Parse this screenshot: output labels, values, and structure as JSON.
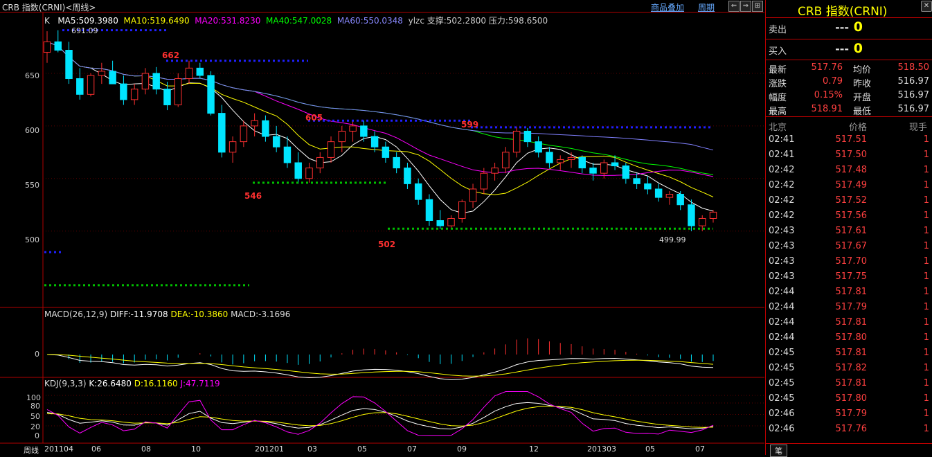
{
  "header": {
    "title": "CRB 指数(CRNI)<周线>",
    "links": [
      "商品叠加",
      "周期"
    ],
    "nav_buttons": [
      "⇐",
      "⇒",
      "⊞",
      "⊟"
    ],
    "close_glyph": "✕"
  },
  "main_legend": {
    "k": "K",
    "ma5": "MA5:509.3980",
    "ma10": "MA10:519.6490",
    "ma20": "MA20:531.8230",
    "ma40": "MA40:547.0028",
    "ma60": "MA60:550.0348",
    "ylzc": "ylzc 支撑:502.2800 压力:598.6500"
  },
  "annotations": {
    "high_691": "691.09",
    "peak_662": "662",
    "peak_605": "605",
    "peak_599": "599",
    "low_546": "546",
    "low_502": "502",
    "low_499": "499.99"
  },
  "macd_legend": {
    "name": "MACD(26,12,9)",
    "diff": "DIFF:-11.9708",
    "dea": "DEA:-10.3860",
    "macd": "MACD:-3.1696"
  },
  "kdj_legend": {
    "name": "KDJ(9,3,3)",
    "k": "K:26.6480",
    "d": "D:16.1160",
    "j": "J:47.7119"
  },
  "y_axis_main": [
    "650",
    "600",
    "550",
    "500"
  ],
  "y_axis_macd": [
    "0"
  ],
  "y_axis_kdj": [
    "100",
    "80",
    "50",
    "20",
    "0"
  ],
  "x_axis": {
    "period_label": "周线",
    "ticks": [
      "201104",
      "06",
      "08",
      "10",
      "201201",
      "03",
      "05",
      "07",
      "09",
      "12",
      "201303",
      "05",
      "07"
    ]
  },
  "colors": {
    "up": "#ff3030",
    "down": "#00e5ff",
    "ma5": "#ffffff",
    "ma10": "#ffff00",
    "ma20": "#ff00ff",
    "ma40": "#00ff00",
    "ma60": "#8080ff",
    "resistance": "#2020ff",
    "support": "#00c000"
  },
  "quote": {
    "title": "CRB 指数(CRNI)",
    "sell_label": "卖出",
    "sell_price": "---",
    "sell_vol": "0",
    "buy_label": "买入",
    "buy_price": "---",
    "buy_vol": "0",
    "stats": [
      {
        "l1": "最新",
        "v1": "517.76",
        "l2": "均价",
        "v2": "518.50"
      },
      {
        "l1": "涨跌",
        "v1": "0.79",
        "l2": "昨收",
        "v2": "516.97"
      },
      {
        "l1": "幅度",
        "v1": "0.15%",
        "l2": "开盘",
        "v2": "516.97"
      },
      {
        "l1": "最高",
        "v1": "518.91",
        "l2": "最低",
        "v2": "516.97"
      }
    ],
    "trades_header": {
      "time": "北京",
      "price": "价格",
      "vol": "现手"
    },
    "trades": [
      {
        "time": "02:41",
        "price": "517.51",
        "vol": "1"
      },
      {
        "time": "02:41",
        "price": "517.50",
        "vol": "1"
      },
      {
        "time": "02:42",
        "price": "517.48",
        "vol": "1"
      },
      {
        "time": "02:42",
        "price": "517.49",
        "vol": "1"
      },
      {
        "time": "02:42",
        "price": "517.52",
        "vol": "1"
      },
      {
        "time": "02:42",
        "price": "517.56",
        "vol": "1"
      },
      {
        "time": "02:43",
        "price": "517.61",
        "vol": "1"
      },
      {
        "time": "02:43",
        "price": "517.67",
        "vol": "1"
      },
      {
        "time": "02:43",
        "price": "517.70",
        "vol": "1"
      },
      {
        "time": "02:43",
        "price": "517.75",
        "vol": "1"
      },
      {
        "time": "02:44",
        "price": "517.81",
        "vol": "1"
      },
      {
        "time": "02:44",
        "price": "517.79",
        "vol": "1"
      },
      {
        "time": "02:44",
        "price": "517.81",
        "vol": "1"
      },
      {
        "time": "02:44",
        "price": "517.80",
        "vol": "1"
      },
      {
        "time": "02:45",
        "price": "517.81",
        "vol": "1"
      },
      {
        "time": "02:45",
        "price": "517.82",
        "vol": "1"
      },
      {
        "time": "02:45",
        "price": "517.81",
        "vol": "1"
      },
      {
        "time": "02:45",
        "price": "517.80",
        "vol": "1"
      },
      {
        "time": "02:46",
        "price": "517.79",
        "vol": "1"
      },
      {
        "time": "02:46",
        "price": "517.76",
        "vol": "1"
      }
    ],
    "bottom_tab": "笔"
  },
  "chart_data": {
    "type": "candlestick",
    "title": "CRB 指数(CRNI)<周线>",
    "ylim": [
      430,
      700
    ],
    "x": [
      "201104",
      "06",
      "08",
      "10",
      "201201",
      "03",
      "05",
      "07",
      "09",
      "12",
      "201303",
      "05",
      "07"
    ],
    "ohlc": [
      [
        670,
        690,
        660,
        680
      ],
      [
        680,
        691,
        670,
        672
      ],
      [
        672,
        680,
        640,
        645
      ],
      [
        645,
        655,
        625,
        630
      ],
      [
        630,
        650,
        628,
        648
      ],
      [
        648,
        660,
        640,
        652
      ],
      [
        652,
        662,
        645,
        640
      ],
      [
        640,
        648,
        620,
        625
      ],
      [
        625,
        640,
        620,
        635
      ],
      [
        635,
        655,
        630,
        650
      ],
      [
        650,
        656,
        630,
        635
      ],
      [
        635,
        642,
        615,
        620
      ],
      [
        620,
        650,
        618,
        645
      ],
      [
        645,
        662,
        640,
        655
      ],
      [
        655,
        660,
        645,
        648
      ],
      [
        648,
        652,
        610,
        612
      ],
      [
        612,
        620,
        570,
        575
      ],
      [
        575,
        590,
        565,
        585
      ],
      [
        585,
        605,
        580,
        600
      ],
      [
        600,
        612,
        590,
        605
      ],
      [
        605,
        610,
        585,
        590
      ],
      [
        590,
        600,
        575,
        580
      ],
      [
        580,
        590,
        560,
        565
      ],
      [
        565,
        575,
        545,
        550
      ],
      [
        550,
        565,
        546,
        560
      ],
      [
        560,
        575,
        555,
        570
      ],
      [
        570,
        590,
        565,
        585
      ],
      [
        585,
        600,
        575,
        595
      ],
      [
        595,
        605,
        585,
        600
      ],
      [
        600,
        605,
        585,
        590
      ],
      [
        590,
        595,
        575,
        580
      ],
      [
        580,
        585,
        565,
        570
      ],
      [
        570,
        575,
        555,
        560
      ],
      [
        560,
        565,
        540,
        545
      ],
      [
        545,
        550,
        525,
        530
      ],
      [
        530,
        535,
        505,
        510
      ],
      [
        510,
        520,
        502,
        505
      ],
      [
        505,
        515,
        503,
        512
      ],
      [
        512,
        530,
        508,
        528
      ],
      [
        528,
        545,
        522,
        540
      ],
      [
        540,
        560,
        535,
        555
      ],
      [
        555,
        565,
        548,
        560
      ],
      [
        560,
        580,
        555,
        575
      ],
      [
        575,
        599,
        570,
        595
      ],
      [
        595,
        598,
        580,
        585
      ],
      [
        585,
        590,
        570,
        575
      ],
      [
        575,
        580,
        560,
        565
      ],
      [
        565,
        572,
        558,
        568
      ],
      [
        568,
        575,
        560,
        570
      ],
      [
        570,
        572,
        555,
        560
      ],
      [
        560,
        565,
        548,
        555
      ],
      [
        555,
        568,
        550,
        565
      ],
      [
        565,
        572,
        558,
        562
      ],
      [
        562,
        565,
        545,
        550
      ],
      [
        550,
        555,
        540,
        545
      ],
      [
        545,
        552,
        535,
        540
      ],
      [
        540,
        545,
        528,
        532
      ],
      [
        532,
        538,
        525,
        535
      ],
      [
        535,
        538,
        520,
        525
      ],
      [
        525,
        530,
        500,
        505
      ],
      [
        505,
        515,
        500,
        512
      ],
      [
        512,
        520,
        508,
        518
      ]
    ],
    "ma": [
      {
        "name": "MA5",
        "last": 509.398
      },
      {
        "name": "MA10",
        "last": 519.649
      },
      {
        "name": "MA20",
        "last": 531.823
      },
      {
        "name": "MA40",
        "last": 547.0028
      },
      {
        "name": "MA60",
        "last": 550.0348
      }
    ],
    "support": 502.28,
    "resistance": 598.65,
    "macd": {
      "diff": -11.9708,
      "dea": -10.386,
      "macd": -3.1696
    },
    "kdj": {
      "k": 26.648,
      "d": 16.116,
      "j": 47.7119
    }
  }
}
